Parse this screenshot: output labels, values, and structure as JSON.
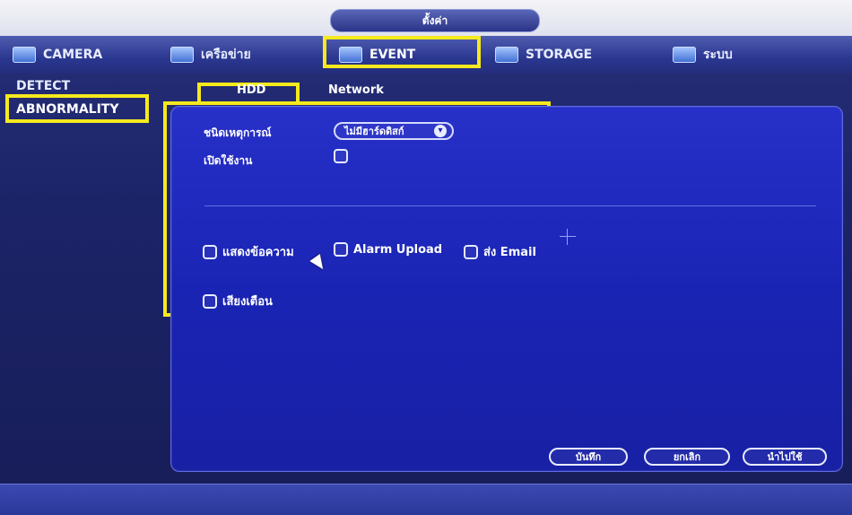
{
  "window": {
    "title": "ตั้งค่า"
  },
  "tabs": [
    {
      "label": "CAMERA",
      "icon": "camera-icon"
    },
    {
      "label": "เครือข่าย",
      "icon": "network-icon"
    },
    {
      "label": "EVENT",
      "icon": "event-icon"
    },
    {
      "label": "STORAGE",
      "icon": "storage-icon"
    },
    {
      "label": "ระบบ",
      "icon": "system-icon"
    }
  ],
  "left_menu": [
    {
      "label": "DETECT"
    },
    {
      "label": "ABNORMALITY"
    }
  ],
  "subtabs": [
    {
      "label": "HDD"
    },
    {
      "label": "Network"
    }
  ],
  "form": {
    "event_type_label": "ชนิดเหตุการณ์",
    "event_type_value": "ไม่มีฮาร์ดดิสก์",
    "enable_label": "เปิดใช้งาน",
    "options": {
      "show_message": "แสดงข้อความ",
      "alarm_upload": "Alarm Upload",
      "send_email": "ส่ง Email",
      "sound": "เสียงเตือน"
    }
  },
  "buttons": {
    "save": "บันทึก",
    "cancel": "ยกเลิก",
    "apply": "นำไปใช้"
  },
  "colors": {
    "highlight": "#f6e91e",
    "panel": "#1f2ab8",
    "tabbar": "#2b3790"
  }
}
